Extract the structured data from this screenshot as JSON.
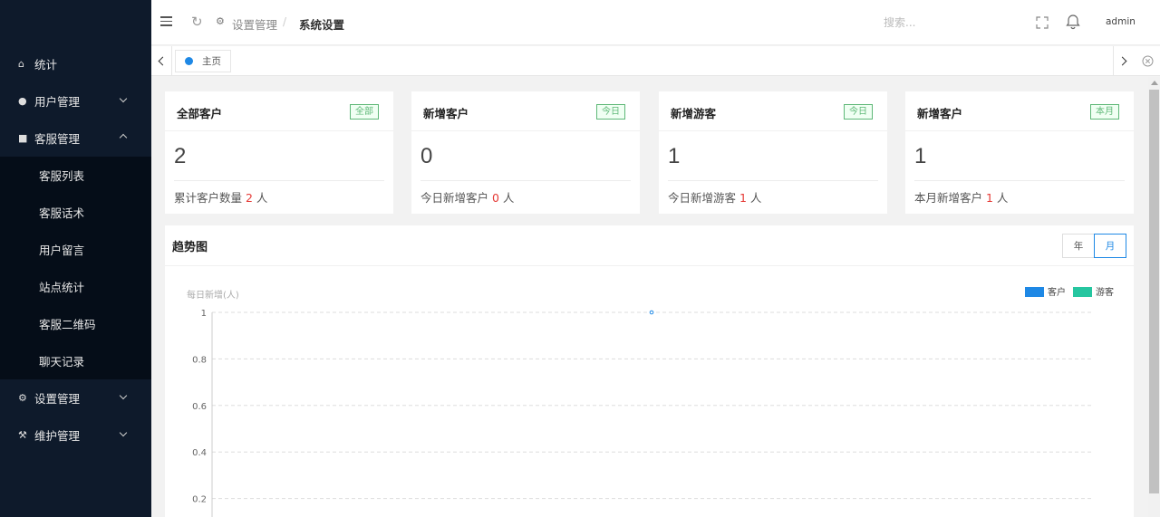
{
  "sidebar": {
    "items": [
      {
        "label": "统计",
        "icon": "home-icon"
      },
      {
        "label": "用户管理",
        "icon": "user-icon"
      },
      {
        "label": "客服管理",
        "icon": "chat-icon"
      },
      {
        "label": "设置管理",
        "icon": "gear-icon"
      },
      {
        "label": "维护管理",
        "icon": "wrench-icon"
      }
    ],
    "submenu": [
      "客服列表",
      "客服话术",
      "用户留言",
      "站点统计",
      "客服二维码",
      "聊天记录"
    ]
  },
  "header": {
    "breadcrumb_parent": "设置管理",
    "breadcrumb_sep": "/",
    "breadcrumb_current": "系统设置",
    "search_placeholder": "搜索...",
    "user": "admin"
  },
  "tabs": {
    "home_label": "主页"
  },
  "cards": [
    {
      "title": "全部客户",
      "badge": "全部",
      "value": "2",
      "foot_prefix": "累计客户数量 ",
      "foot_num": "2",
      "foot_suffix": " 人"
    },
    {
      "title": "新增客户",
      "badge": "今日",
      "value": "0",
      "foot_prefix": "今日新增客户 ",
      "foot_num": "0",
      "foot_suffix": " 人"
    },
    {
      "title": "新增游客",
      "badge": "今日",
      "value": "1",
      "foot_prefix": "今日新增游客 ",
      "foot_num": "1",
      "foot_suffix": " 人"
    },
    {
      "title": "新增客户",
      "badge": "本月",
      "value": "1",
      "foot_prefix": "本月新增客户 ",
      "foot_num": "1",
      "foot_suffix": " 人"
    }
  ],
  "trend": {
    "title": "趋势图",
    "btn_year": "年",
    "btn_month": "月"
  },
  "colors": {
    "sidebar_bg": "#0e1a2b",
    "accent": "#1e88e5",
    "badge_green": "#5fb878",
    "series_customer": "#1e88e5",
    "series_visitor": "#26c6a0"
  },
  "chart_data": {
    "type": "line",
    "ylabel": "每日新增(人)",
    "ylim": [
      0,
      1
    ],
    "yticks": [
      "1",
      "0.8",
      "0.6",
      "0.4",
      "0.2"
    ],
    "ytick_values": [
      1,
      0.8,
      0.6,
      0.4,
      0.2
    ],
    "grid": true,
    "legend_position": "top-right",
    "series": [
      {
        "name": "客户",
        "color": "#1e88e5",
        "points": [
          {
            "x_frac_of_axis": 0.5,
            "y": 1
          }
        ]
      },
      {
        "name": "游客",
        "color": "#26c6a0",
        "points": []
      }
    ]
  }
}
